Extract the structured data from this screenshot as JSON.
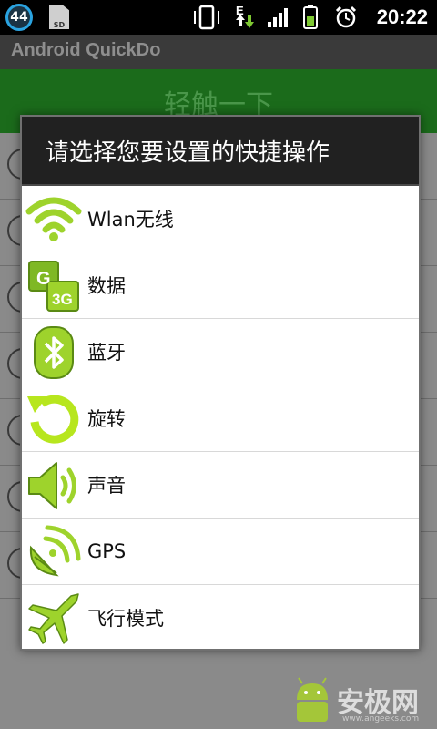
{
  "status_bar": {
    "notification_count": "44",
    "sd_label": "SD",
    "network_label": "E",
    "time": "20:22"
  },
  "app": {
    "title": "Android QuickDo",
    "header": "轻触一下"
  },
  "dialog": {
    "title": "请选择您要设置的快捷操作",
    "items": [
      {
        "label": "Wlan无线",
        "icon": "wifi-icon"
      },
      {
        "label": "数据",
        "icon": "data-3g-icon"
      },
      {
        "label": "蓝牙",
        "icon": "bluetooth-icon"
      },
      {
        "label": "旋转",
        "icon": "rotate-icon"
      },
      {
        "label": "声音",
        "icon": "sound-icon"
      },
      {
        "label": "GPS",
        "icon": "gps-icon"
      },
      {
        "label": "飞行模式",
        "icon": "airplane-icon"
      }
    ]
  },
  "watermark": {
    "text": "安极网",
    "url": "www.angeeks.com"
  },
  "colors": {
    "icon_green": "#9ed32c",
    "header_green": "#1b6b1b",
    "dialog_title_bg": "#212121"
  }
}
